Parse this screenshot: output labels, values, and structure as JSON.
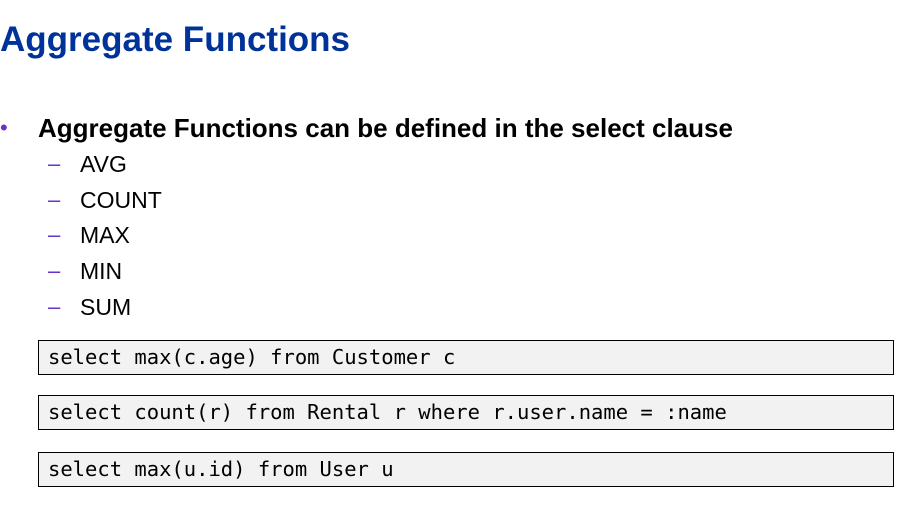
{
  "slide": {
    "title": "Aggregate Functions",
    "bullet": {
      "marker": "•",
      "text": "Aggregate Functions can be defined in the select clause"
    },
    "sub_marker": "–",
    "sub_items": [
      "AVG",
      "COUNT",
      "MAX",
      "MIN",
      "SUM"
    ],
    "code_examples": [
      "select max(c.age) from Customer c",
      "select count(r) from Rental r where r.user.name = :name",
      "select max(u.id) from User u"
    ]
  },
  "colors": {
    "title": "#003399",
    "bullet_marker": "#6633cc",
    "code_background": "#f2f2f2"
  }
}
